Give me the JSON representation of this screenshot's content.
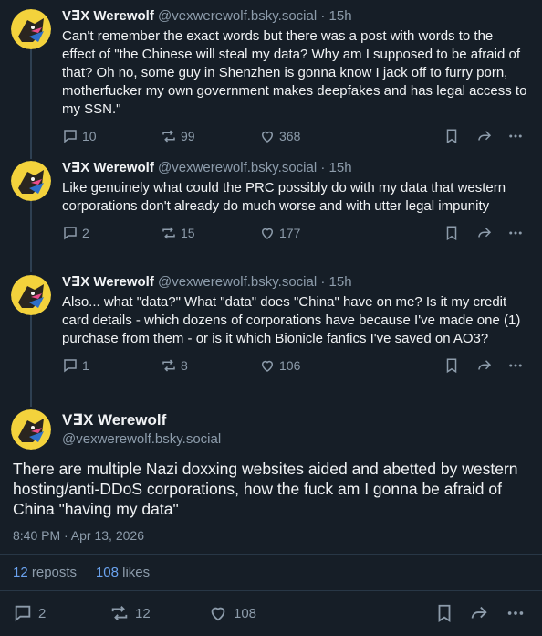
{
  "posts": [
    {
      "author": "V∃X Werewolf",
      "handle": "@vexwerewolf.bsky.social",
      "separator": "·",
      "time": "15h",
      "text": "Can't remember the exact words but there was a post with words to the effect of \"the Chinese will steal my data? Why am I supposed to be afraid of that? Oh no, some guy in Shenzhen is gonna know I jack off to furry porn, motherfucker my own government makes deepfakes and has legal access to my SSN.\"",
      "replies": "10",
      "reposts": "99",
      "likes": "368"
    },
    {
      "author": "V∃X Werewolf",
      "handle": "@vexwerewolf.bsky.social",
      "separator": "·",
      "time": "15h",
      "text": "Like genuinely what could the PRC possibly do with my data that western corporations don't already do much worse and with utter legal impunity",
      "replies": "2",
      "reposts": "15",
      "likes": "177"
    },
    {
      "author": "V∃X Werewolf",
      "handle": "@vexwerewolf.bsky.social",
      "separator": "·",
      "time": "15h",
      "text": "Also... what \"data?\" What \"data\" does \"China\" have on me? Is it my credit card details - which dozens of corporations have because I've made one (1) purchase from them - or is it which Bionicle fanfics I've saved on AO3?",
      "replies": "1",
      "reposts": "8",
      "likes": "106"
    }
  ],
  "main": {
    "author": "V∃X Werewolf",
    "handle": "@vexwerewolf.bsky.social",
    "text": "There are multiple Nazi doxxing websites aided and abetted by western hosting/anti-DDoS corporations, how the fuck am I gonna be afraid of China \"having my data\"",
    "datetime": "8:40 PM · Apr 13, 2026",
    "reposts_count": "12",
    "reposts_label": "reposts",
    "likes_count": "108",
    "likes_label": "likes",
    "replies": "2",
    "reposts": "12",
    "likes": "108"
  },
  "colors": {
    "background": "#161e27",
    "muted": "#8d9cab",
    "accent": "#6ba3ef",
    "text": "#f1f3f5"
  },
  "icons": [
    "avatar-image",
    "reply-icon",
    "repost-icon",
    "like-icon",
    "bookmark-icon",
    "share-icon",
    "more-icon"
  ]
}
